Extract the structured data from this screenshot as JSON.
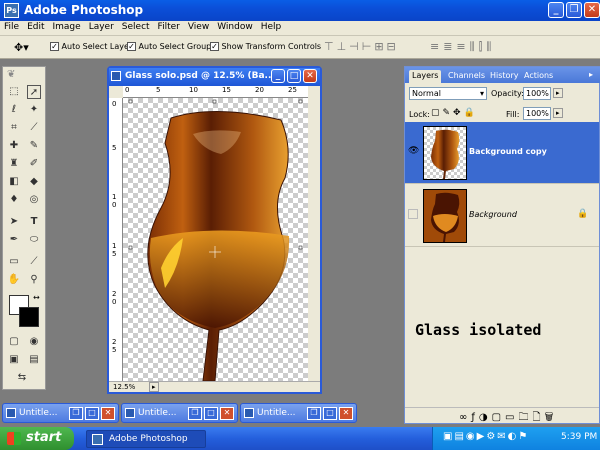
{
  "app": {
    "title": "Adobe Photoshop"
  },
  "menu": [
    "File",
    "Edit",
    "Image",
    "Layer",
    "Select",
    "Filter",
    "View",
    "Window",
    "Help"
  ],
  "options": {
    "auto_select_layer": "Auto Select Layer",
    "auto_select_groups": "Auto Select Groups",
    "show_transform_controls": "Show Transform Controls"
  },
  "document": {
    "title": "Glass solo.psd @ 12.5% (Ba...",
    "zoom": "12.5%",
    "ruler_h": [
      "0",
      "5",
      "10",
      "15",
      "20",
      "25"
    ],
    "ruler_v": [
      "0",
      "5",
      "1 0",
      "1 5",
      "2 0",
      "2 5"
    ]
  },
  "layers_panel": {
    "tabs": [
      "Layers",
      "Channels",
      "History",
      "Actions"
    ],
    "blend_mode": "Normal",
    "opacity_label": "Opacity:",
    "opacity_value": "100%",
    "lock_label": "Lock:",
    "fill_label": "Fill:",
    "fill_value": "100%",
    "layers": [
      {
        "name": "Background copy",
        "visible": true,
        "selected": true
      },
      {
        "name": "Background",
        "visible": false,
        "selected": false,
        "locked": true
      }
    ],
    "annotation": "Glass isolated"
  },
  "minimized_windows": [
    "Untitle...",
    "Untitle...",
    "Untitle..."
  ],
  "taskbar": {
    "start_label": "start",
    "task_label": "Adobe Photoshop",
    "clock": "5:39 PM"
  },
  "colors": {
    "xp_blue": "#0b4fd8",
    "selection": "#3a6ad0"
  }
}
